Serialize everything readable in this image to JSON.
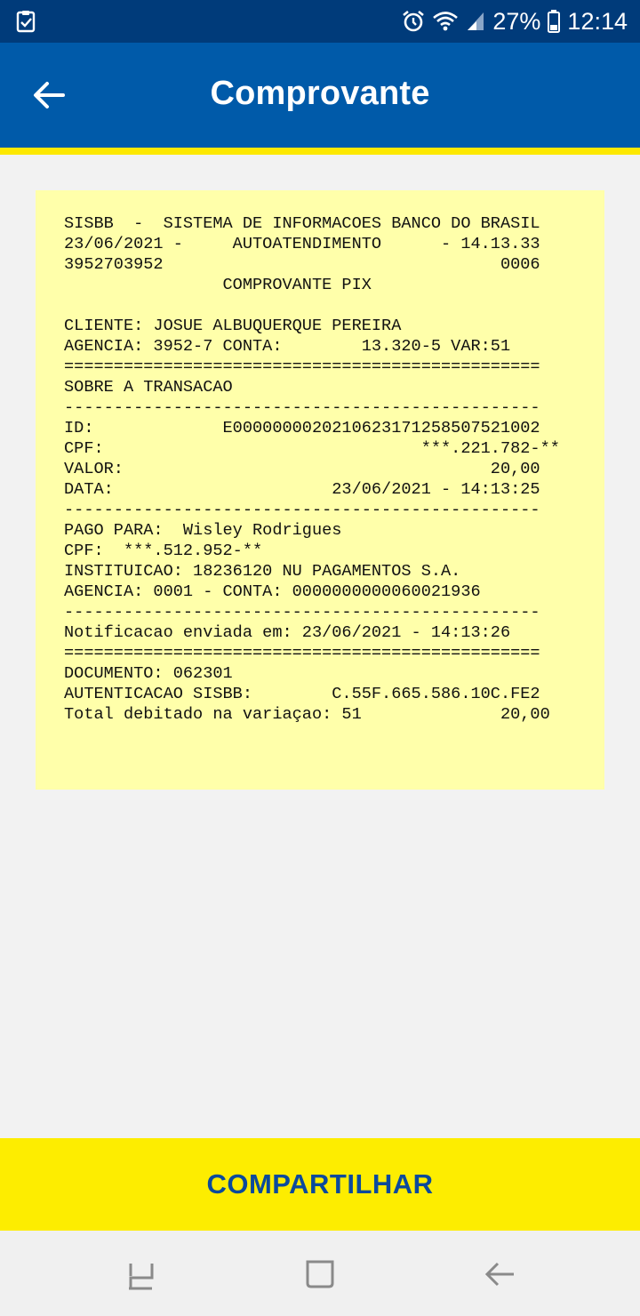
{
  "status_bar": {
    "battery": "27%",
    "time": "12:14",
    "icons": [
      "task-check-icon",
      "alarm-icon",
      "wifi-icon",
      "signal-icon",
      "battery-icon"
    ]
  },
  "header": {
    "title": "Comprovante",
    "back_icon": "arrow-left-icon"
  },
  "receipt": {
    "lines": [
      "SISBB  -  SISTEMA DE INFORMACOES BANCO DO BRASIL",
      "23/06/2021 -     AUTOATENDIMENTO      - 14.13.33",
      "3952703952                                  0006",
      "                COMPROVANTE PIX",
      "",
      "CLIENTE: JOSUE ALBUQUERQUE PEREIRA",
      "AGENCIA: 3952-7 CONTA:        13.320-5 VAR:51",
      "================================================",
      "SOBRE A TRANSACAO",
      "------------------------------------------------",
      "ID:             E0000000020210623171258507521002",
      "CPF:                                ***.221.782-**",
      "VALOR:                                     20,00",
      "DATA:                      23/06/2021 - 14:13:25",
      "------------------------------------------------",
      "PAGO PARA:  Wisley Rodrigues",
      "CPF:  ***.512.952-**",
      "INSTITUICAO: 18236120 NU PAGAMENTOS S.A.",
      "AGENCIA: 0001 - CONTA: 0000000000060021936",
      "------------------------------------------------",
      "Notificacao enviada em: 23/06/2021 - 14:13:26",
      "================================================",
      "DOCUMENTO: 062301",
      "AUTENTICACAO SISBB:        C.55F.665.586.10C.FE2",
      "Total debitado na variaçao: 51              20,00"
    ]
  },
  "actions": {
    "share_label": "COMPARTILHAR"
  },
  "nav": {
    "items": [
      "recents-icon",
      "home-icon",
      "back-icon"
    ]
  },
  "colors": {
    "status_bar": "#003b7a",
    "app_bar": "#005aa9",
    "accent_yellow": "#fde800",
    "receipt_bg": "#ffffaa",
    "share_text": "#0b4a9c"
  }
}
